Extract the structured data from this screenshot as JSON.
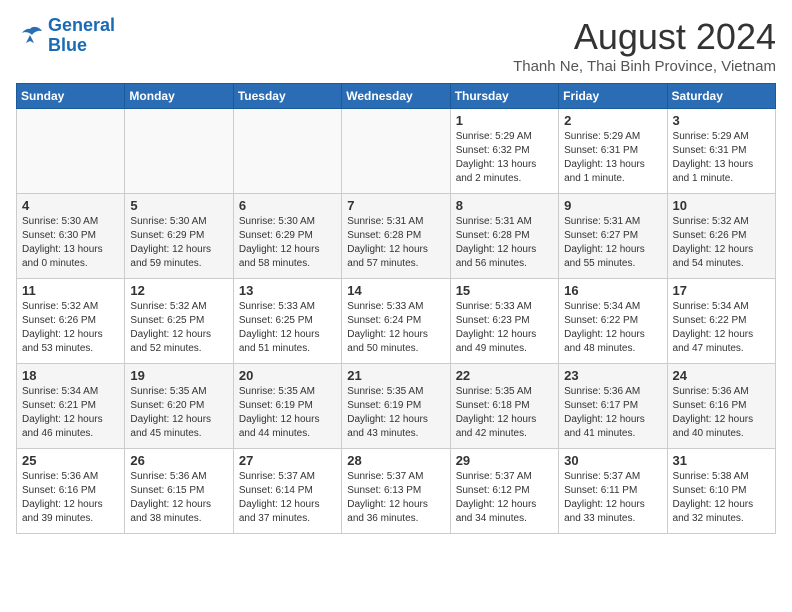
{
  "logo": {
    "line1": "General",
    "line2": "Blue"
  },
  "title": "August 2024",
  "location": "Thanh Ne, Thai Binh Province, Vietnam",
  "days_of_week": [
    "Sunday",
    "Monday",
    "Tuesday",
    "Wednesday",
    "Thursday",
    "Friday",
    "Saturday"
  ],
  "weeks": [
    [
      {
        "day": "",
        "info": ""
      },
      {
        "day": "",
        "info": ""
      },
      {
        "day": "",
        "info": ""
      },
      {
        "day": "",
        "info": ""
      },
      {
        "day": "1",
        "info": "Sunrise: 5:29 AM\nSunset: 6:32 PM\nDaylight: 13 hours\nand 2 minutes."
      },
      {
        "day": "2",
        "info": "Sunrise: 5:29 AM\nSunset: 6:31 PM\nDaylight: 13 hours\nand 1 minute."
      },
      {
        "day": "3",
        "info": "Sunrise: 5:29 AM\nSunset: 6:31 PM\nDaylight: 13 hours\nand 1 minute."
      }
    ],
    [
      {
        "day": "4",
        "info": "Sunrise: 5:30 AM\nSunset: 6:30 PM\nDaylight: 13 hours\nand 0 minutes."
      },
      {
        "day": "5",
        "info": "Sunrise: 5:30 AM\nSunset: 6:29 PM\nDaylight: 12 hours\nand 59 minutes."
      },
      {
        "day": "6",
        "info": "Sunrise: 5:30 AM\nSunset: 6:29 PM\nDaylight: 12 hours\nand 58 minutes."
      },
      {
        "day": "7",
        "info": "Sunrise: 5:31 AM\nSunset: 6:28 PM\nDaylight: 12 hours\nand 57 minutes."
      },
      {
        "day": "8",
        "info": "Sunrise: 5:31 AM\nSunset: 6:28 PM\nDaylight: 12 hours\nand 56 minutes."
      },
      {
        "day": "9",
        "info": "Sunrise: 5:31 AM\nSunset: 6:27 PM\nDaylight: 12 hours\nand 55 minutes."
      },
      {
        "day": "10",
        "info": "Sunrise: 5:32 AM\nSunset: 6:26 PM\nDaylight: 12 hours\nand 54 minutes."
      }
    ],
    [
      {
        "day": "11",
        "info": "Sunrise: 5:32 AM\nSunset: 6:26 PM\nDaylight: 12 hours\nand 53 minutes."
      },
      {
        "day": "12",
        "info": "Sunrise: 5:32 AM\nSunset: 6:25 PM\nDaylight: 12 hours\nand 52 minutes."
      },
      {
        "day": "13",
        "info": "Sunrise: 5:33 AM\nSunset: 6:25 PM\nDaylight: 12 hours\nand 51 minutes."
      },
      {
        "day": "14",
        "info": "Sunrise: 5:33 AM\nSunset: 6:24 PM\nDaylight: 12 hours\nand 50 minutes."
      },
      {
        "day": "15",
        "info": "Sunrise: 5:33 AM\nSunset: 6:23 PM\nDaylight: 12 hours\nand 49 minutes."
      },
      {
        "day": "16",
        "info": "Sunrise: 5:34 AM\nSunset: 6:22 PM\nDaylight: 12 hours\nand 48 minutes."
      },
      {
        "day": "17",
        "info": "Sunrise: 5:34 AM\nSunset: 6:22 PM\nDaylight: 12 hours\nand 47 minutes."
      }
    ],
    [
      {
        "day": "18",
        "info": "Sunrise: 5:34 AM\nSunset: 6:21 PM\nDaylight: 12 hours\nand 46 minutes."
      },
      {
        "day": "19",
        "info": "Sunrise: 5:35 AM\nSunset: 6:20 PM\nDaylight: 12 hours\nand 45 minutes."
      },
      {
        "day": "20",
        "info": "Sunrise: 5:35 AM\nSunset: 6:19 PM\nDaylight: 12 hours\nand 44 minutes."
      },
      {
        "day": "21",
        "info": "Sunrise: 5:35 AM\nSunset: 6:19 PM\nDaylight: 12 hours\nand 43 minutes."
      },
      {
        "day": "22",
        "info": "Sunrise: 5:35 AM\nSunset: 6:18 PM\nDaylight: 12 hours\nand 42 minutes."
      },
      {
        "day": "23",
        "info": "Sunrise: 5:36 AM\nSunset: 6:17 PM\nDaylight: 12 hours\nand 41 minutes."
      },
      {
        "day": "24",
        "info": "Sunrise: 5:36 AM\nSunset: 6:16 PM\nDaylight: 12 hours\nand 40 minutes."
      }
    ],
    [
      {
        "day": "25",
        "info": "Sunrise: 5:36 AM\nSunset: 6:16 PM\nDaylight: 12 hours\nand 39 minutes."
      },
      {
        "day": "26",
        "info": "Sunrise: 5:36 AM\nSunset: 6:15 PM\nDaylight: 12 hours\nand 38 minutes."
      },
      {
        "day": "27",
        "info": "Sunrise: 5:37 AM\nSunset: 6:14 PM\nDaylight: 12 hours\nand 37 minutes."
      },
      {
        "day": "28",
        "info": "Sunrise: 5:37 AM\nSunset: 6:13 PM\nDaylight: 12 hours\nand 36 minutes."
      },
      {
        "day": "29",
        "info": "Sunrise: 5:37 AM\nSunset: 6:12 PM\nDaylight: 12 hours\nand 34 minutes."
      },
      {
        "day": "30",
        "info": "Sunrise: 5:37 AM\nSunset: 6:11 PM\nDaylight: 12 hours\nand 33 minutes."
      },
      {
        "day": "31",
        "info": "Sunrise: 5:38 AM\nSunset: 6:10 PM\nDaylight: 12 hours\nand 32 minutes."
      }
    ]
  ]
}
